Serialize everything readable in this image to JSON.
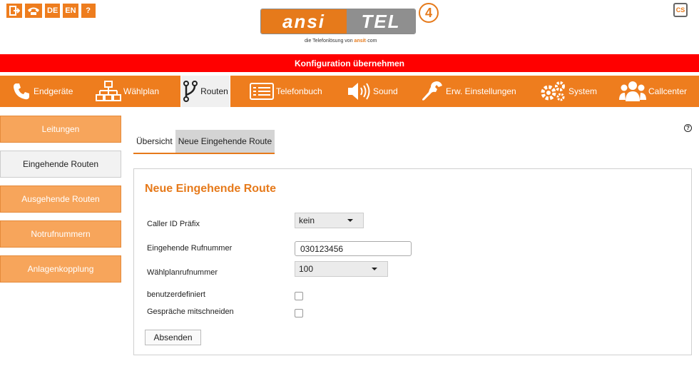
{
  "top": {
    "lang_de": "DE",
    "lang_en": "EN",
    "help_symbol": "?",
    "cs_label": "CS"
  },
  "logo": {
    "ansi": "ansi",
    "tel": "TEL",
    "version": "4",
    "tagline_prefix": "die Telefonlösung von",
    "tagline_brand": "ansit",
    "tagline_suffix": "com"
  },
  "banner": {
    "text": "Konfiguration übernehmen"
  },
  "nav": {
    "items": [
      {
        "label": "Endgeräte",
        "icon": "phone-icon"
      },
      {
        "label": "Wählplan",
        "icon": "sitemap-icon"
      },
      {
        "label": "Routen",
        "icon": "routes-icon",
        "active": true
      },
      {
        "label": "Telefonbuch",
        "icon": "list-icon"
      },
      {
        "label": "Sound",
        "icon": "speaker-icon"
      },
      {
        "label": "Erw. Einstellungen",
        "icon": "wrench-icon"
      },
      {
        "label": "System",
        "icon": "gears-icon"
      },
      {
        "label": "Callcenter",
        "icon": "users-icon"
      }
    ]
  },
  "sidebar": {
    "items": [
      {
        "label": "Leitungen"
      },
      {
        "label": "Eingehende Routen",
        "active": true
      },
      {
        "label": "Ausgehende Routen"
      },
      {
        "label": "Notrufnummern"
      },
      {
        "label": "Anlagenkopplung"
      }
    ]
  },
  "help": {
    "symbol": "?"
  },
  "tabs": [
    {
      "label": "Übersicht"
    },
    {
      "label": "Neue Eingehende Route",
      "active": true
    }
  ],
  "form": {
    "title": "Neue Eingehende Route",
    "caller_id_label": "Caller ID Präfix",
    "caller_id_value": "kein",
    "incoming_number_label": "Eingehende Rufnummer",
    "incoming_number_value": "030123456",
    "dialplan_label": "Wählplanrufnummer",
    "dialplan_value": "100",
    "custom_label": "benutzerdefiniert",
    "record_label": "Gespräche mitschneiden",
    "submit_label": "Absenden"
  },
  "colors": {
    "accent": "#ee7d1e",
    "banner": "#ff0000",
    "sidebar": "#f7a55b"
  }
}
